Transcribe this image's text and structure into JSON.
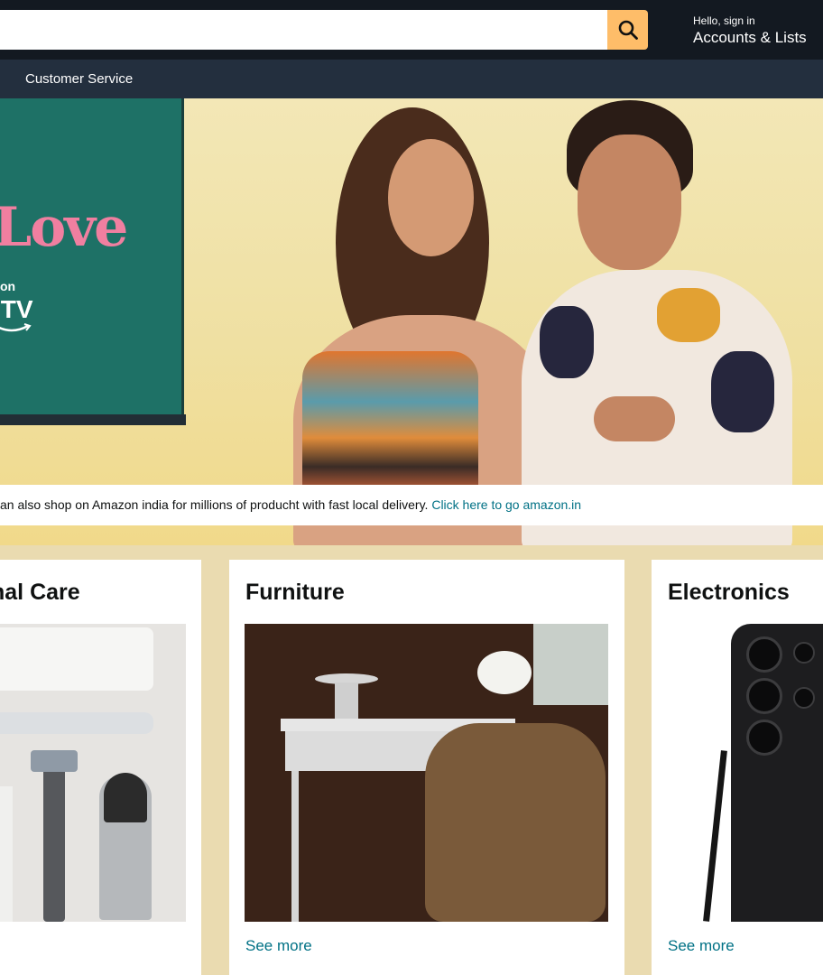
{
  "header": {
    "search": {
      "placeholder": ""
    },
    "account": {
      "greeting": "Hello, sign in",
      "label": "Accounts & Lists"
    }
  },
  "nav": {
    "items": [
      "Customer Service"
    ]
  },
  "hero": {
    "love_text": "Love",
    "brand_top": "zon",
    "brand_bottom": "iTV"
  },
  "notice": {
    "text": "an also shop on Amazon india for millions of producht with fast local delivery. ",
    "link": "Click here to go amazon.in"
  },
  "cards": [
    {
      "title": "nal Care",
      "see_more": ""
    },
    {
      "title": "Furniture",
      "see_more": "See more"
    },
    {
      "title": "Electronics",
      "see_more": "See more"
    }
  ],
  "colors": {
    "header_bg": "#131921",
    "nav_bg": "#232f3e",
    "search_button": "#febd69",
    "link": "#007185",
    "page_bg": "#eadbb0"
  }
}
